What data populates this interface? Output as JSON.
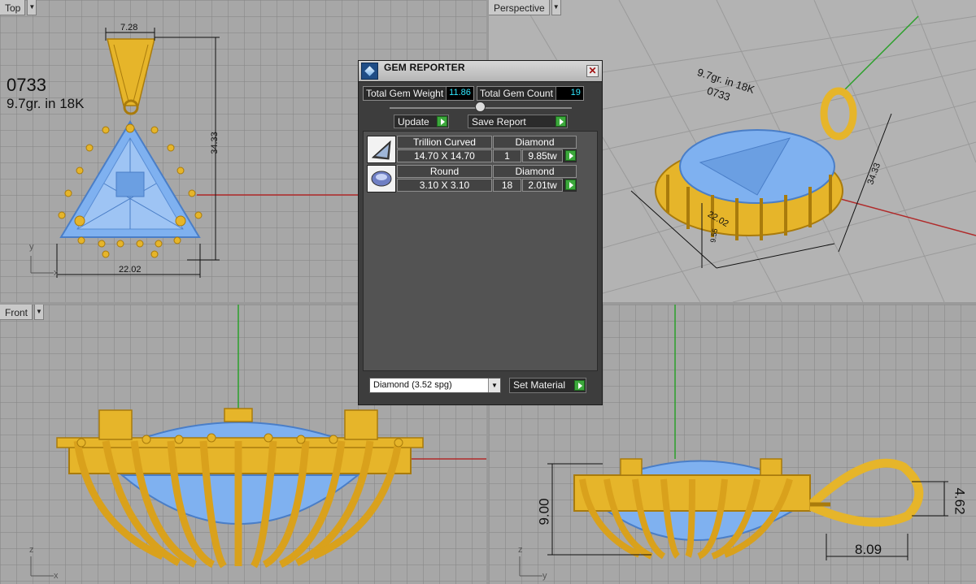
{
  "viewports": {
    "top": {
      "title": "Top"
    },
    "perspective": {
      "title": "Perspective"
    },
    "front": {
      "title": "Front"
    }
  },
  "annotations": {
    "part_number": "0733",
    "weight_note": "9.7gr.  in 18K",
    "top_width": "7.28",
    "top_height": "34.33",
    "top_base": "22.02",
    "persp_note1": "9.7gr.  in 18K",
    "persp_note2": "0733",
    "persp_dim1": "34.33",
    "persp_dim2": "22.02",
    "persp_dim3": "9.55",
    "right_height": "9.00",
    "right_loop_height": "4.62",
    "right_loop_width": "8.09"
  },
  "axes": {
    "x": "x",
    "y": "y",
    "z": "z"
  },
  "gem_reporter": {
    "title": "GEM REPORTER",
    "total_weight_label": "Total Gem Weight",
    "total_weight_value": "11.86",
    "total_count_label": "Total Gem Count",
    "total_count_value": "19",
    "update_label": "Update",
    "save_report_label": "Save Report",
    "gems": [
      {
        "shape": "Trillion Curved",
        "material": "Diamond",
        "size": "14.70 X 14.70",
        "count": "1",
        "weight": "9.85tw"
      },
      {
        "shape": "Round",
        "material": "Diamond",
        "size": "3.10 X 3.10",
        "count": "18",
        "weight": "2.01tw"
      }
    ],
    "material_select": "Diamond     (3.52 spg)",
    "set_material_label": "Set Material"
  },
  "colors": {
    "gold": "#e6b52a",
    "gold_dark": "#a97b0c",
    "gem_blue": "#7fb1f0",
    "axis_red": "#b02a2a",
    "axis_green": "#2aa02a"
  }
}
